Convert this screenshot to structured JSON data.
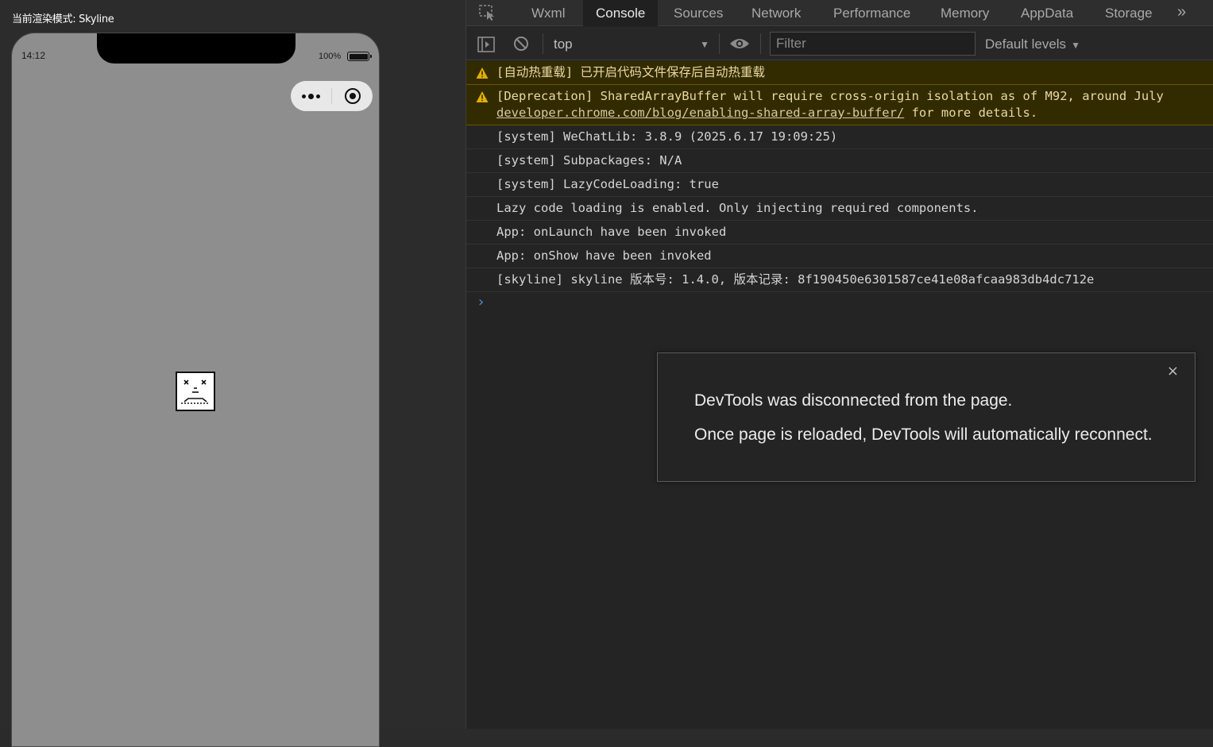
{
  "simulator": {
    "render_mode_label": "当前渲染模式: Skyline",
    "status_bar": {
      "time": "14:12",
      "battery_percent": "100%",
      "battery_level": 1.0
    },
    "capsule": {
      "menu_icon": "more-dots-icon",
      "close_icon": "target-circle-icon"
    },
    "page_content_icon": "sad-face-broken-page-icon",
    "colors": {
      "page_background": "#8e8e8e",
      "chrome_background": "#2c2c2c"
    }
  },
  "devtools": {
    "inspect_icon": "element-select-icon",
    "tabs": [
      {
        "label": "Wxml",
        "active": false
      },
      {
        "label": "Console",
        "active": true
      },
      {
        "label": "Sources",
        "active": false
      },
      {
        "label": "Network",
        "active": false
      },
      {
        "label": "Performance",
        "active": false
      },
      {
        "label": "Memory",
        "active": false
      },
      {
        "label": "AppData",
        "active": false
      },
      {
        "label": "Storage",
        "active": false
      }
    ],
    "more_tabs_label": "»",
    "toolbar": {
      "sidebar_toggle_icon": "sidebar-toggle-icon",
      "clear_icon": "clear-console-icon",
      "context_value": "top",
      "context_caret": "▼",
      "eye_icon": "eye-icon",
      "filter_placeholder": "Filter",
      "filter_value": "",
      "levels_label": "Default levels",
      "levels_caret": "▼"
    },
    "console": {
      "messages": [
        {
          "level": "warning",
          "text": "[自动热重载] 已开启代码文件保存后自动热重载"
        },
        {
          "level": "warning",
          "text": "[Deprecation] SharedArrayBuffer will require cross-origin isolation as of M92, around July",
          "link": "developer.chrome.com/blog/enabling-shared-array-buffer/",
          "suffix": " for more details."
        },
        {
          "level": "info",
          "text": "[system] WeChatLib: 3.8.9 (2025.6.17 19:09:25)"
        },
        {
          "level": "info",
          "text": "[system] Subpackages: N/A"
        },
        {
          "level": "info",
          "text": "[system] LazyCodeLoading: true"
        },
        {
          "level": "info",
          "text": "Lazy code loading is enabled. Only injecting required components."
        },
        {
          "level": "info",
          "text": "App: onLaunch have been invoked"
        },
        {
          "level": "info",
          "text": "App: onShow have been invoked"
        },
        {
          "level": "info",
          "text": "[skyline] skyline 版本号: 1.4.0, 版本记录: 8f190450e6301587ce41e08afcaa983db4dc712e"
        }
      ],
      "prompt_symbol": "›"
    },
    "disconnect_dialog": {
      "close_label": "×",
      "line1": "DevTools was disconnected from the page.",
      "line2": "Once page is reloaded, DevTools will automatically reconnect."
    },
    "colors": {
      "warning_background": "#332b00",
      "warning_icon": "#e0b000",
      "prompt_accent": "#4f8fd6",
      "active_tab_background": "#202020"
    }
  }
}
